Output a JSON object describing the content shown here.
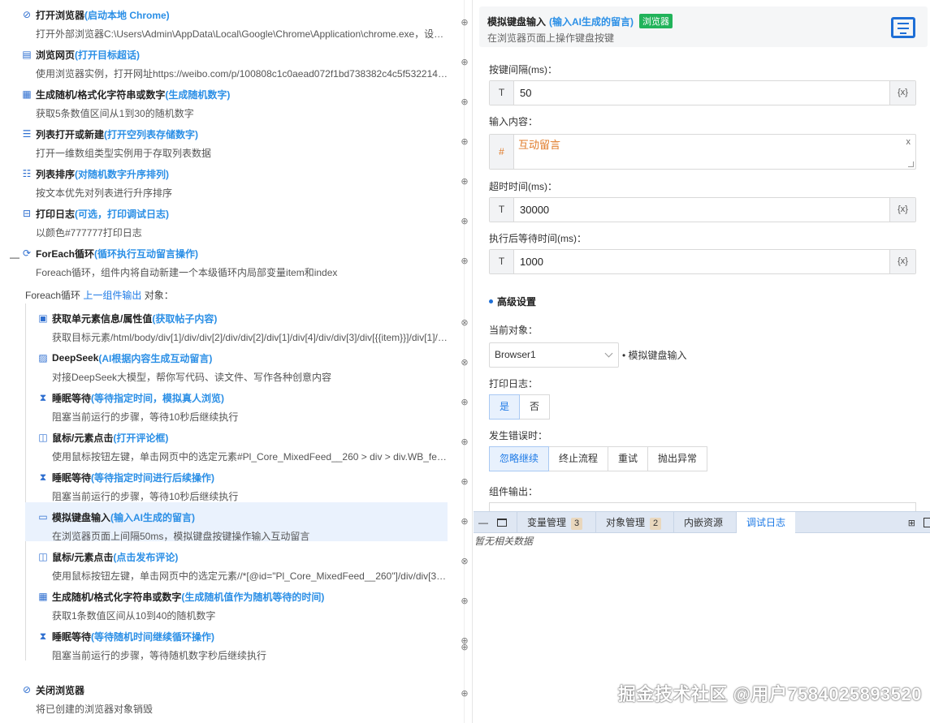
{
  "steps": [
    {
      "name": "打开浏览器",
      "alias": "(启动本地 Chrome)",
      "desc": "打开外部浏览器C:\\Users\\Admin\\AppData\\Local\\Google\\Chrome\\Application\\chrome.exe，设…",
      "icon": "compass-icon"
    },
    {
      "name": "浏览网页",
      "alias": "(打开目标超话)",
      "desc": "使用浏览器实例，打开网址https://weibo.com/p/100808c1c0aead072f1bd738382c4c5f532214/…",
      "icon": "webpage-icon"
    },
    {
      "name": "生成随机/格式化字符串或数字",
      "alias": "(生成随机数字)",
      "desc": "获取5条数值区间从1到30的随机数字",
      "icon": "calculator-icon"
    },
    {
      "name": "列表打开或新建",
      "alias": "(打开空列表存储数字)",
      "desc": "打开一维数组类型实例用于存取列表数据",
      "icon": "list-icon"
    },
    {
      "name": "列表排序",
      "alias": "(对随机数字升序排列)",
      "desc": "按文本优先对列表进行升序排序",
      "icon": "list-sort-icon"
    },
    {
      "name": "打印日志",
      "alias": "(可选，打印调试日志)",
      "desc": "以颜色#777777打印日志",
      "icon": "log-icon"
    },
    {
      "name": "ForEach循环",
      "alias": " (循环执行互动留言操作)",
      "desc": "Foreach循环，组件内将自动新建一个本级循环内局部变量item和index",
      "icon": "loop-icon"
    }
  ],
  "foreach_line": {
    "prefix": "Foreach循环 ",
    "link": "上一组件输出",
    "suffix": " 对象："
  },
  "inner_steps": [
    {
      "name": "获取单元素信息/属性值",
      "alias": "(获取帖子内容)",
      "desc": "获取目标元素/html/body/div[1]/div/div[2]/div/div[2]/div[1]/div[4]/div/div[3]/div[{{item}}]/div[1]/…",
      "icon": "element-info-icon"
    },
    {
      "name": "DeepSeek",
      "alias": "(AI根据内容生成互动留言)",
      "desc": "对接DeepSeek大模型，帮你写代码、读文件、写作各种创意内容",
      "icon": "ai-icon"
    },
    {
      "name": "睡眠等待",
      "alias": "(等待指定时间，模拟真人浏览)",
      "desc": "阻塞当前运行的步骤，等待10秒后继续执行",
      "icon": "hourglass-icon"
    },
    {
      "name": "鼠标/元素点击",
      "alias": "(打开评论框)",
      "desc": "使用鼠标按钮左键，单击网页中的选定元素#Pl_Core_MixedFeed__260 > div > div.WB_fe…",
      "icon": "mouse-icon"
    },
    {
      "name": "睡眠等待",
      "alias": "(等待指定时间进行后续操作)",
      "desc": "阻塞当前运行的步骤，等待10秒后继续执行",
      "icon": "hourglass-icon"
    },
    {
      "name": "模拟键盘输入",
      "alias": "(输入AI生成的留言)",
      "desc": "在浏览器页面上间隔50ms，模拟键盘按键操作输入互动留言",
      "icon": "keyboard-icon"
    },
    {
      "name": "鼠标/元素点击",
      "alias": "(点击发布评论)",
      "desc": "使用鼠标按钮左键，单击网页中的选定元素//*[@id=\"Pl_Core_MixedFeed__260\"]/div/div[3]…",
      "icon": "mouse-icon"
    },
    {
      "name": "生成随机/格式化字符串或数字",
      "alias": "(生成随机值作为随机等待的时间)",
      "desc": "获取1条数值区间从10到40的随机数字",
      "icon": "calculator-icon"
    },
    {
      "name": "睡眠等待",
      "alias": "(等待随机时间继续循环操作)",
      "desc": "阻塞当前运行的步骤，等待随机数字秒后继续执行",
      "icon": "hourglass-icon"
    }
  ],
  "final_step": {
    "name": "关闭浏览器",
    "alias": "",
    "desc": "将已创建的浏览器对象销毁",
    "icon": "close-browser-icon"
  },
  "panel": {
    "title": "模拟键盘输入",
    "alias": "(输入AI生成的留言)",
    "tag": "浏览器",
    "subtitle": "在浏览器页面上操作键盘按键",
    "icon": "keyboard-icon",
    "interval_label": "按键间隔(ms)：",
    "interval_prefix": "T",
    "interval_value": "50",
    "var_button": "{x}",
    "content_label": "输入内容：",
    "content_prefix": "#",
    "content_value": "互动留言",
    "clear_icon": "x",
    "timeout_label": "超时时间(ms)：",
    "timeout_prefix": "T",
    "timeout_value": "30000",
    "wait_label": "执行后等待时间(ms)：",
    "wait_prefix": "T",
    "wait_value": "1000",
    "advanced_label": "高级设置",
    "current_object_label": "当前对象：",
    "current_object_value": "Browser1",
    "current_object_suffix": "• 模拟键盘输入",
    "print_log_label": "打印日志：",
    "print_log_options": [
      "是",
      "否"
    ],
    "print_log_selected": "是",
    "on_error_label": "发生错误时：",
    "on_error_options": [
      "忽略继续",
      "终止流程",
      "重试",
      "抛出异常"
    ],
    "on_error_selected": "忽略继续",
    "output_label": "组件输出："
  },
  "bottom_tabs": [
    {
      "label": "变量管理",
      "count": "3"
    },
    {
      "label": "对象管理",
      "count": "2"
    },
    {
      "label": "内嵌资源",
      "count": ""
    },
    {
      "label": "调试日志",
      "count": ""
    }
  ],
  "bottom_active": "调试日志",
  "bottom_empty": "暂无相关数据",
  "minimize_glyph": "—",
  "collapse_glyph": "—",
  "watermark": "掘金技术社区 @用户7584025893520",
  "colors": {
    "accent": "#1e7ae6",
    "alias": "#2b8fe6",
    "tag_green": "#21b35a",
    "content_orange": "#e07b29",
    "selected_bg": "#eaf2fd"
  }
}
